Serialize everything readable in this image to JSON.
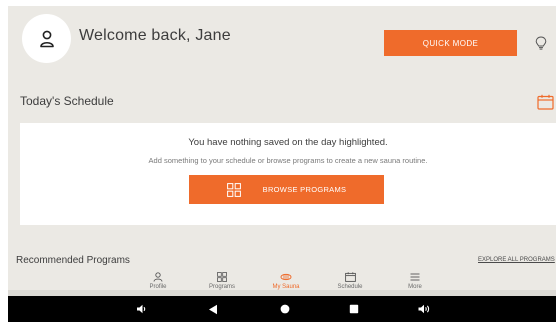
{
  "header": {
    "welcome_text": "Welcome back, Jane",
    "quick_mode_label": "QUICK MODE"
  },
  "schedule": {
    "section_title": "Today's Schedule",
    "empty_title": "You have nothing saved on the day highlighted.",
    "empty_subtitle": "Add something to your schedule or browse programs to create a new sauna routine.",
    "browse_label": "BROWSE PROGRAMS"
  },
  "recommended": {
    "title": "Recommended Programs",
    "explore_label": "EXPLORE ALL PROGRAMS"
  },
  "bottom_nav": {
    "items": [
      {
        "label": "Profile",
        "icon": "profile-icon",
        "active": false
      },
      {
        "label": "Programs",
        "icon": "programs-grid-icon",
        "active": false
      },
      {
        "label": "My Sauna",
        "icon": "sauna-icon",
        "active": true
      },
      {
        "label": "Schedule",
        "icon": "calendar-icon",
        "active": false
      },
      {
        "label": "More",
        "icon": "menu-icon",
        "active": false
      }
    ]
  },
  "system_bar": {
    "buttons": [
      "volume-down-icon",
      "back-icon",
      "home-icon",
      "recents-icon",
      "volume-up-icon"
    ]
  },
  "colors": {
    "accent": "#ef6b2b",
    "background": "#ebe9e4",
    "card": "#ffffff",
    "text": "#3d3d3d"
  }
}
